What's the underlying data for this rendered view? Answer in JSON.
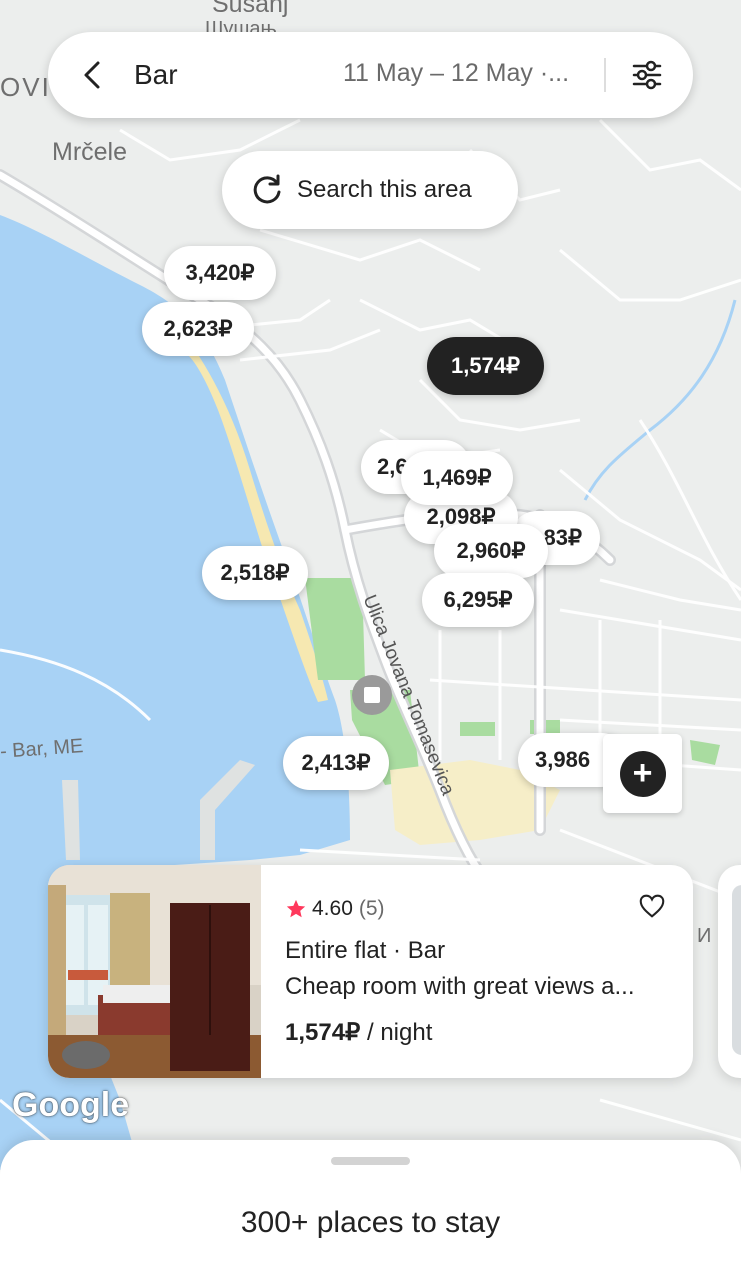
{
  "search": {
    "location": "Bar",
    "dates": "11 May – 12 May ·...",
    "search_area_label": "Search this area"
  },
  "map": {
    "labels": {
      "top_city": "Susanj",
      "top_city_cyr": "Шушањ",
      "mrcele": "Mrčele",
      "left_edge": "OVI",
      "bar_me": "- Bar, ME",
      "right_edge": "И"
    },
    "street_name": "Ulica Jovana Tomasevica",
    "price_pins": [
      {
        "label": "3,420₽",
        "selected": false
      },
      {
        "label": "2,623₽",
        "selected": false
      },
      {
        "label": "1,574₽",
        "selected": true
      },
      {
        "label": "2,6",
        "selected": false
      },
      {
        "label": "1,469₽",
        "selected": false
      },
      {
        "label": "2,098₽",
        "selected": false
      },
      {
        "label": "83₽",
        "selected": false
      },
      {
        "label": "2,960₽",
        "selected": false
      },
      {
        "label": "2,518₽",
        "selected": false
      },
      {
        "label": "6,295₽",
        "selected": false
      },
      {
        "label": "2,413₽",
        "selected": false
      },
      {
        "label": "3,986",
        "selected": false
      }
    ],
    "attribution": "Google",
    "colors": {
      "water": "#a8d2f5",
      "land": "#eceeed",
      "park": "#a9dca0",
      "beach": "#f6e8b1",
      "selected_pin": "#222222"
    }
  },
  "listing": {
    "rating": "4.60",
    "review_count": "(5)",
    "type": "Entire flat · Bar",
    "title": "Cheap room with great views a...",
    "price": "1,574₽",
    "price_unit": " / night",
    "rating_star_color": "#ff385c"
  },
  "sheet": {
    "title": "300+ places to stay"
  }
}
